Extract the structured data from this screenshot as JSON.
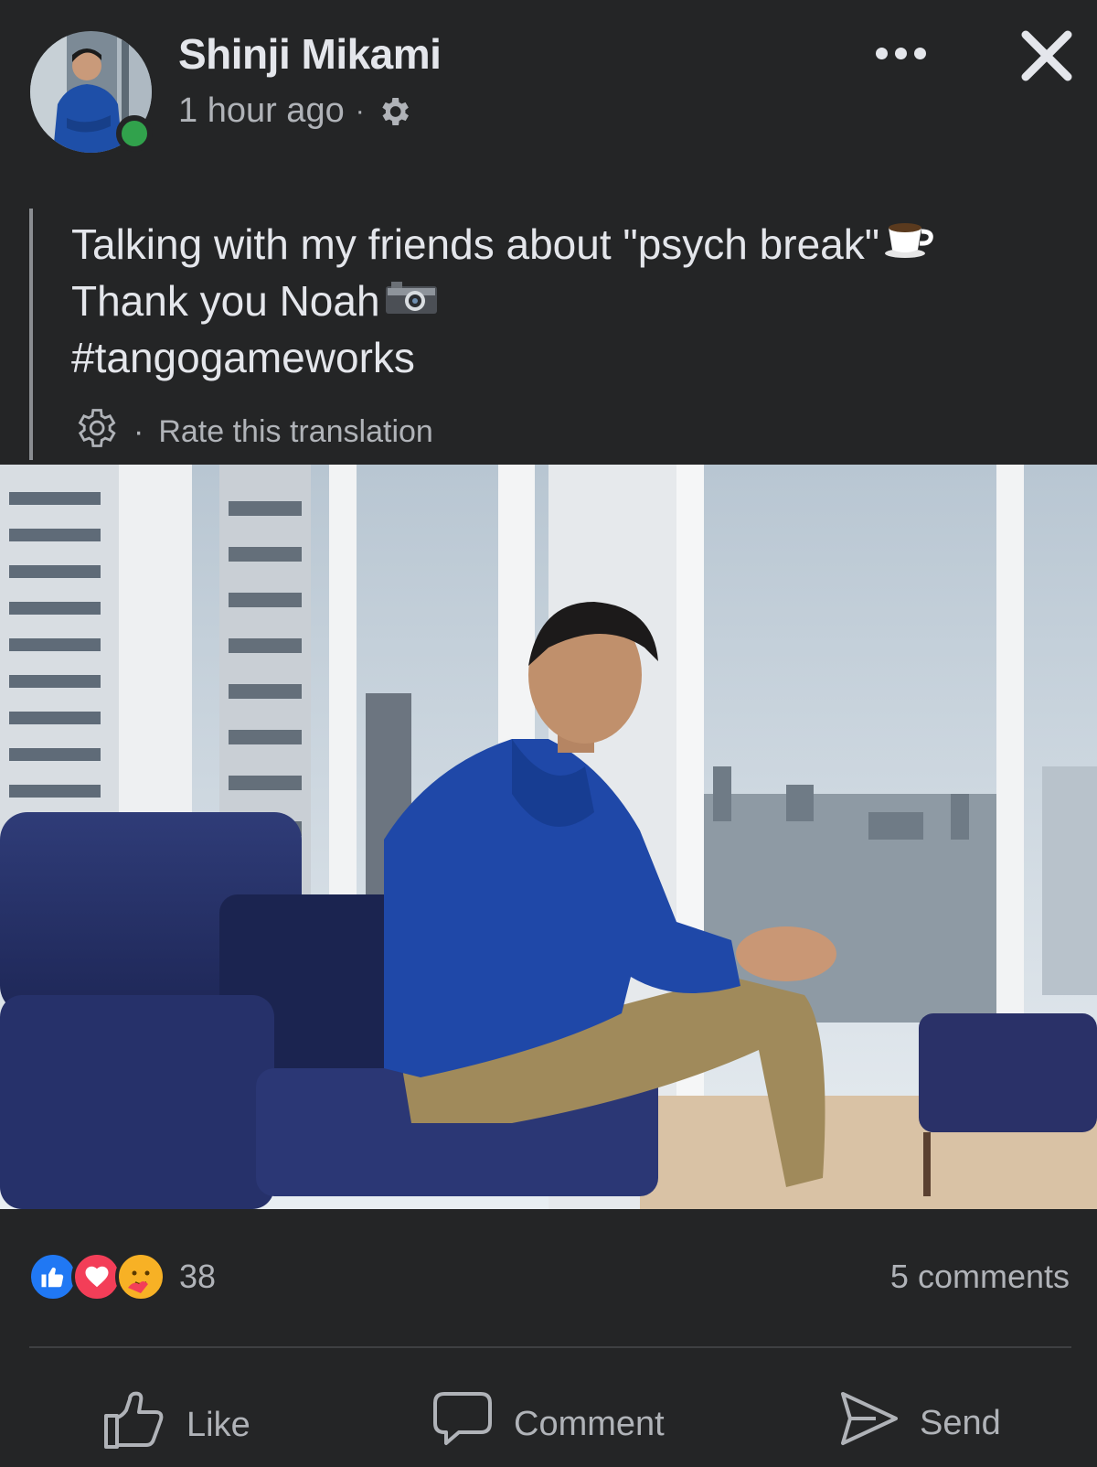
{
  "post": {
    "author": "Shinji Mikami",
    "timestamp": "1 hour ago",
    "separator": "·",
    "privacy_icon": "gear-icon",
    "text_lines": [
      "Talking with my friends about \"psych break\"",
      "Thank you Noah ",
      "#tangogameworks"
    ],
    "emojis": [
      "coffee-icon",
      "camera-icon"
    ],
    "translation_label": "Rate this translation",
    "online": true
  },
  "reactions": {
    "types": [
      "like",
      "love",
      "care"
    ],
    "count": "38"
  },
  "comments_label": "5 comments",
  "actions": {
    "like": "Like",
    "comment": "Comment",
    "send": "Send"
  },
  "colors": {
    "background": "#242526",
    "text": "#e4e6eb",
    "muted": "#b0b3b8",
    "online": "#31a24c",
    "like_blue": "#2078f4",
    "love_red": "#f33e58",
    "care_yellow": "#f7b125"
  }
}
